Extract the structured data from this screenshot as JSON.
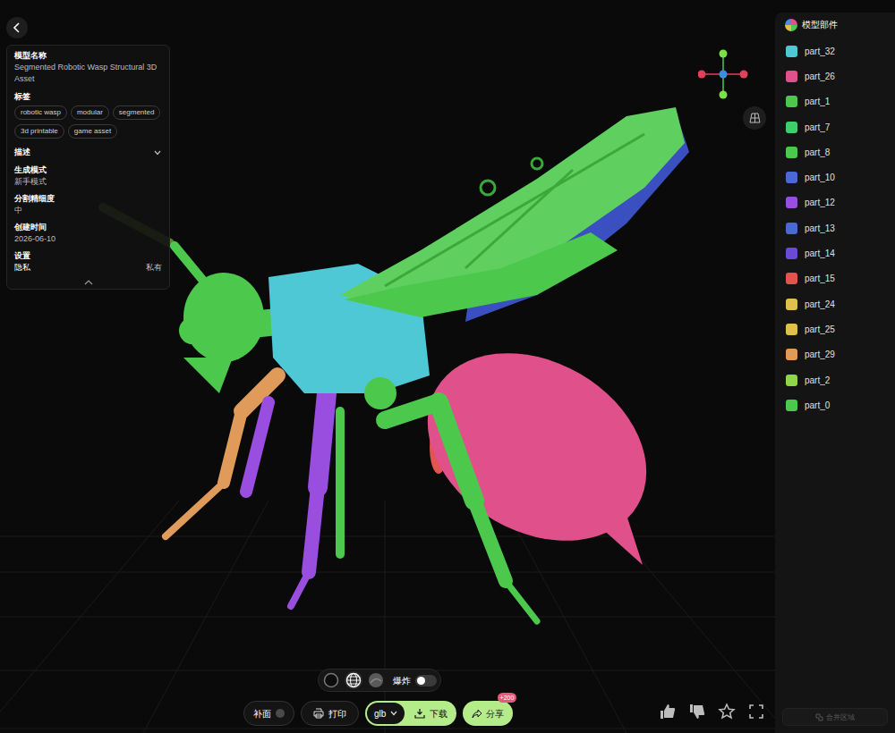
{
  "info_panel": {
    "expanded": true,
    "model_name": {
      "label": "模型名称",
      "value": "Segmented Robotic Wasp Structural 3D Asset"
    },
    "tags": {
      "label": "标签",
      "items": [
        "robotic wasp",
        "modular",
        "segmented",
        "3d printable",
        "game asset"
      ]
    },
    "description": {
      "label": "描述",
      "expanded": false
    },
    "generation_mode": {
      "label": "生成模式",
      "value": "新手模式"
    },
    "segmentation": {
      "label": "分割精细度",
      "value": "中"
    },
    "created": {
      "label": "创建时间",
      "value": "2026-06-10"
    },
    "settings": {
      "label": "设置",
      "rows": [
        {
          "label": "隐私",
          "value": "私有"
        }
      ]
    }
  },
  "parts_panel": {
    "title": "模型部件",
    "items": [
      {
        "name": "part_32",
        "color": "#4fc8d6"
      },
      {
        "name": "part_26",
        "color": "#e0508a"
      },
      {
        "name": "part_1",
        "color": "#4cc94c"
      },
      {
        "name": "part_7",
        "color": "#3fcf6a"
      },
      {
        "name": "part_8",
        "color": "#4cc94c"
      },
      {
        "name": "part_10",
        "color": "#4a68d6"
      },
      {
        "name": "part_12",
        "color": "#9a4ee0"
      },
      {
        "name": "part_13",
        "color": "#4a68d6"
      },
      {
        "name": "part_14",
        "color": "#6a4ad6"
      },
      {
        "name": "part_15",
        "color": "#e0564e"
      },
      {
        "name": "part_24",
        "color": "#e0c04a"
      },
      {
        "name": "part_25",
        "color": "#e0c04a"
      },
      {
        "name": "part_29",
        "color": "#e09a5a"
      },
      {
        "name": "part_2",
        "color": "#8fd64a"
      },
      {
        "name": "part_0",
        "color": "#4cc94c"
      }
    ],
    "merge_button": {
      "label": "合并区域",
      "disabled": true
    }
  },
  "view_modes": [
    {
      "kind": "solid",
      "selected": false
    },
    {
      "kind": "wireframe",
      "selected": true
    },
    {
      "kind": "textured",
      "selected": false
    }
  ],
  "explode": {
    "label": "爆炸",
    "on": false
  },
  "toolbar": {
    "fill_holes": {
      "label": "补面",
      "on": false
    },
    "print": {
      "label": "打印"
    },
    "format": {
      "value": "glb"
    },
    "download": {
      "label": "下载"
    },
    "share": {
      "label": "分享",
      "badge": "+200"
    }
  }
}
